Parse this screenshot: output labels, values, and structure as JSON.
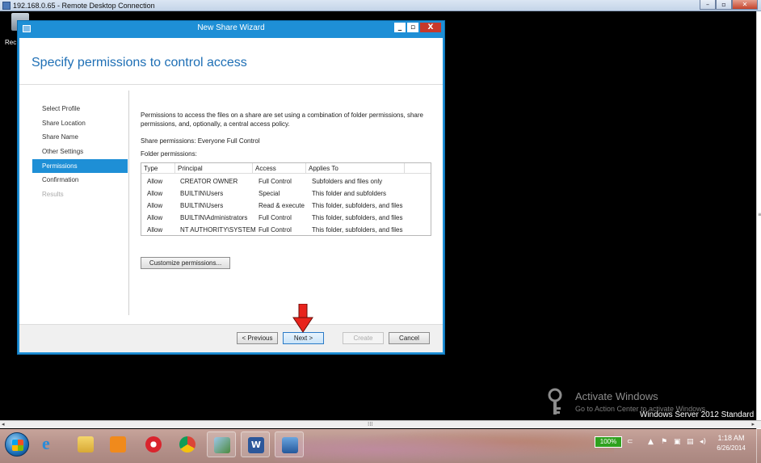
{
  "rdp": {
    "title": "192.168.0.65 - Remote Desktop Connection",
    "controls": [
      "–",
      "▫",
      "✕"
    ],
    "desktop_label": "Rec"
  },
  "wizard": {
    "title": "New Share Wizard",
    "controls": [
      "_",
      "▫",
      "X"
    ],
    "heading": "Specify permissions to control access",
    "nav": [
      {
        "label": "Select Profile",
        "state": "normal"
      },
      {
        "label": "Share Location",
        "state": "normal"
      },
      {
        "label": "Share Name",
        "state": "normal"
      },
      {
        "label": "Other Settings",
        "state": "normal"
      },
      {
        "label": "Permissions",
        "state": "active"
      },
      {
        "label": "Confirmation",
        "state": "normal"
      },
      {
        "label": "Results",
        "state": "disabled"
      }
    ],
    "description": "Permissions to access the files on a share are set using a combination of folder permissions, share permissions, and, optionally, a central access policy.",
    "share_permissions": "Share permissions: Everyone Full Control",
    "folder_permissions_label": "Folder permissions:",
    "table": {
      "columns": [
        "Type",
        "Principal",
        "Access",
        "Applies To"
      ],
      "rows": [
        [
          "Allow",
          "CREATOR OWNER",
          "Full Control",
          "Subfolders and files only"
        ],
        [
          "Allow",
          "BUILTIN\\Users",
          "Special",
          "This folder and subfolders"
        ],
        [
          "Allow",
          "BUILTIN\\Users",
          "Read & execute",
          "This folder, subfolders, and files"
        ],
        [
          "Allow",
          "BUILTIN\\Administrators",
          "Full Control",
          "This folder, subfolders, and files"
        ],
        [
          "Allow",
          "NT AUTHORITY\\SYSTEM",
          "Full Control",
          "This folder, subfolders, and files"
        ]
      ]
    },
    "customize_button": "Customize permissions...",
    "buttons": {
      "previous": "< Previous",
      "next": "Next >",
      "create": "Create",
      "cancel": "Cancel"
    }
  },
  "watermark": {
    "title": "Activate Windows",
    "subtitle": "Go to Action Center to activate Windows.",
    "edition": "Windows Server 2012 Standard"
  },
  "taskbar": {
    "items": [
      "start-button",
      "internet-explorer-icon",
      "file-explorer-icon",
      "media-player-icon",
      "chrome-alt-icon",
      "chrome-icon",
      "photos-icon",
      "word-icon",
      "remote-desktop-icon"
    ],
    "battery": "100%",
    "time": "1:18 AM",
    "date": "6/26/2014"
  },
  "colors": {
    "wizard_accent": "#1e8fd6",
    "heading": "#1e6fb5",
    "annotation_arrow": "#e8231c"
  }
}
